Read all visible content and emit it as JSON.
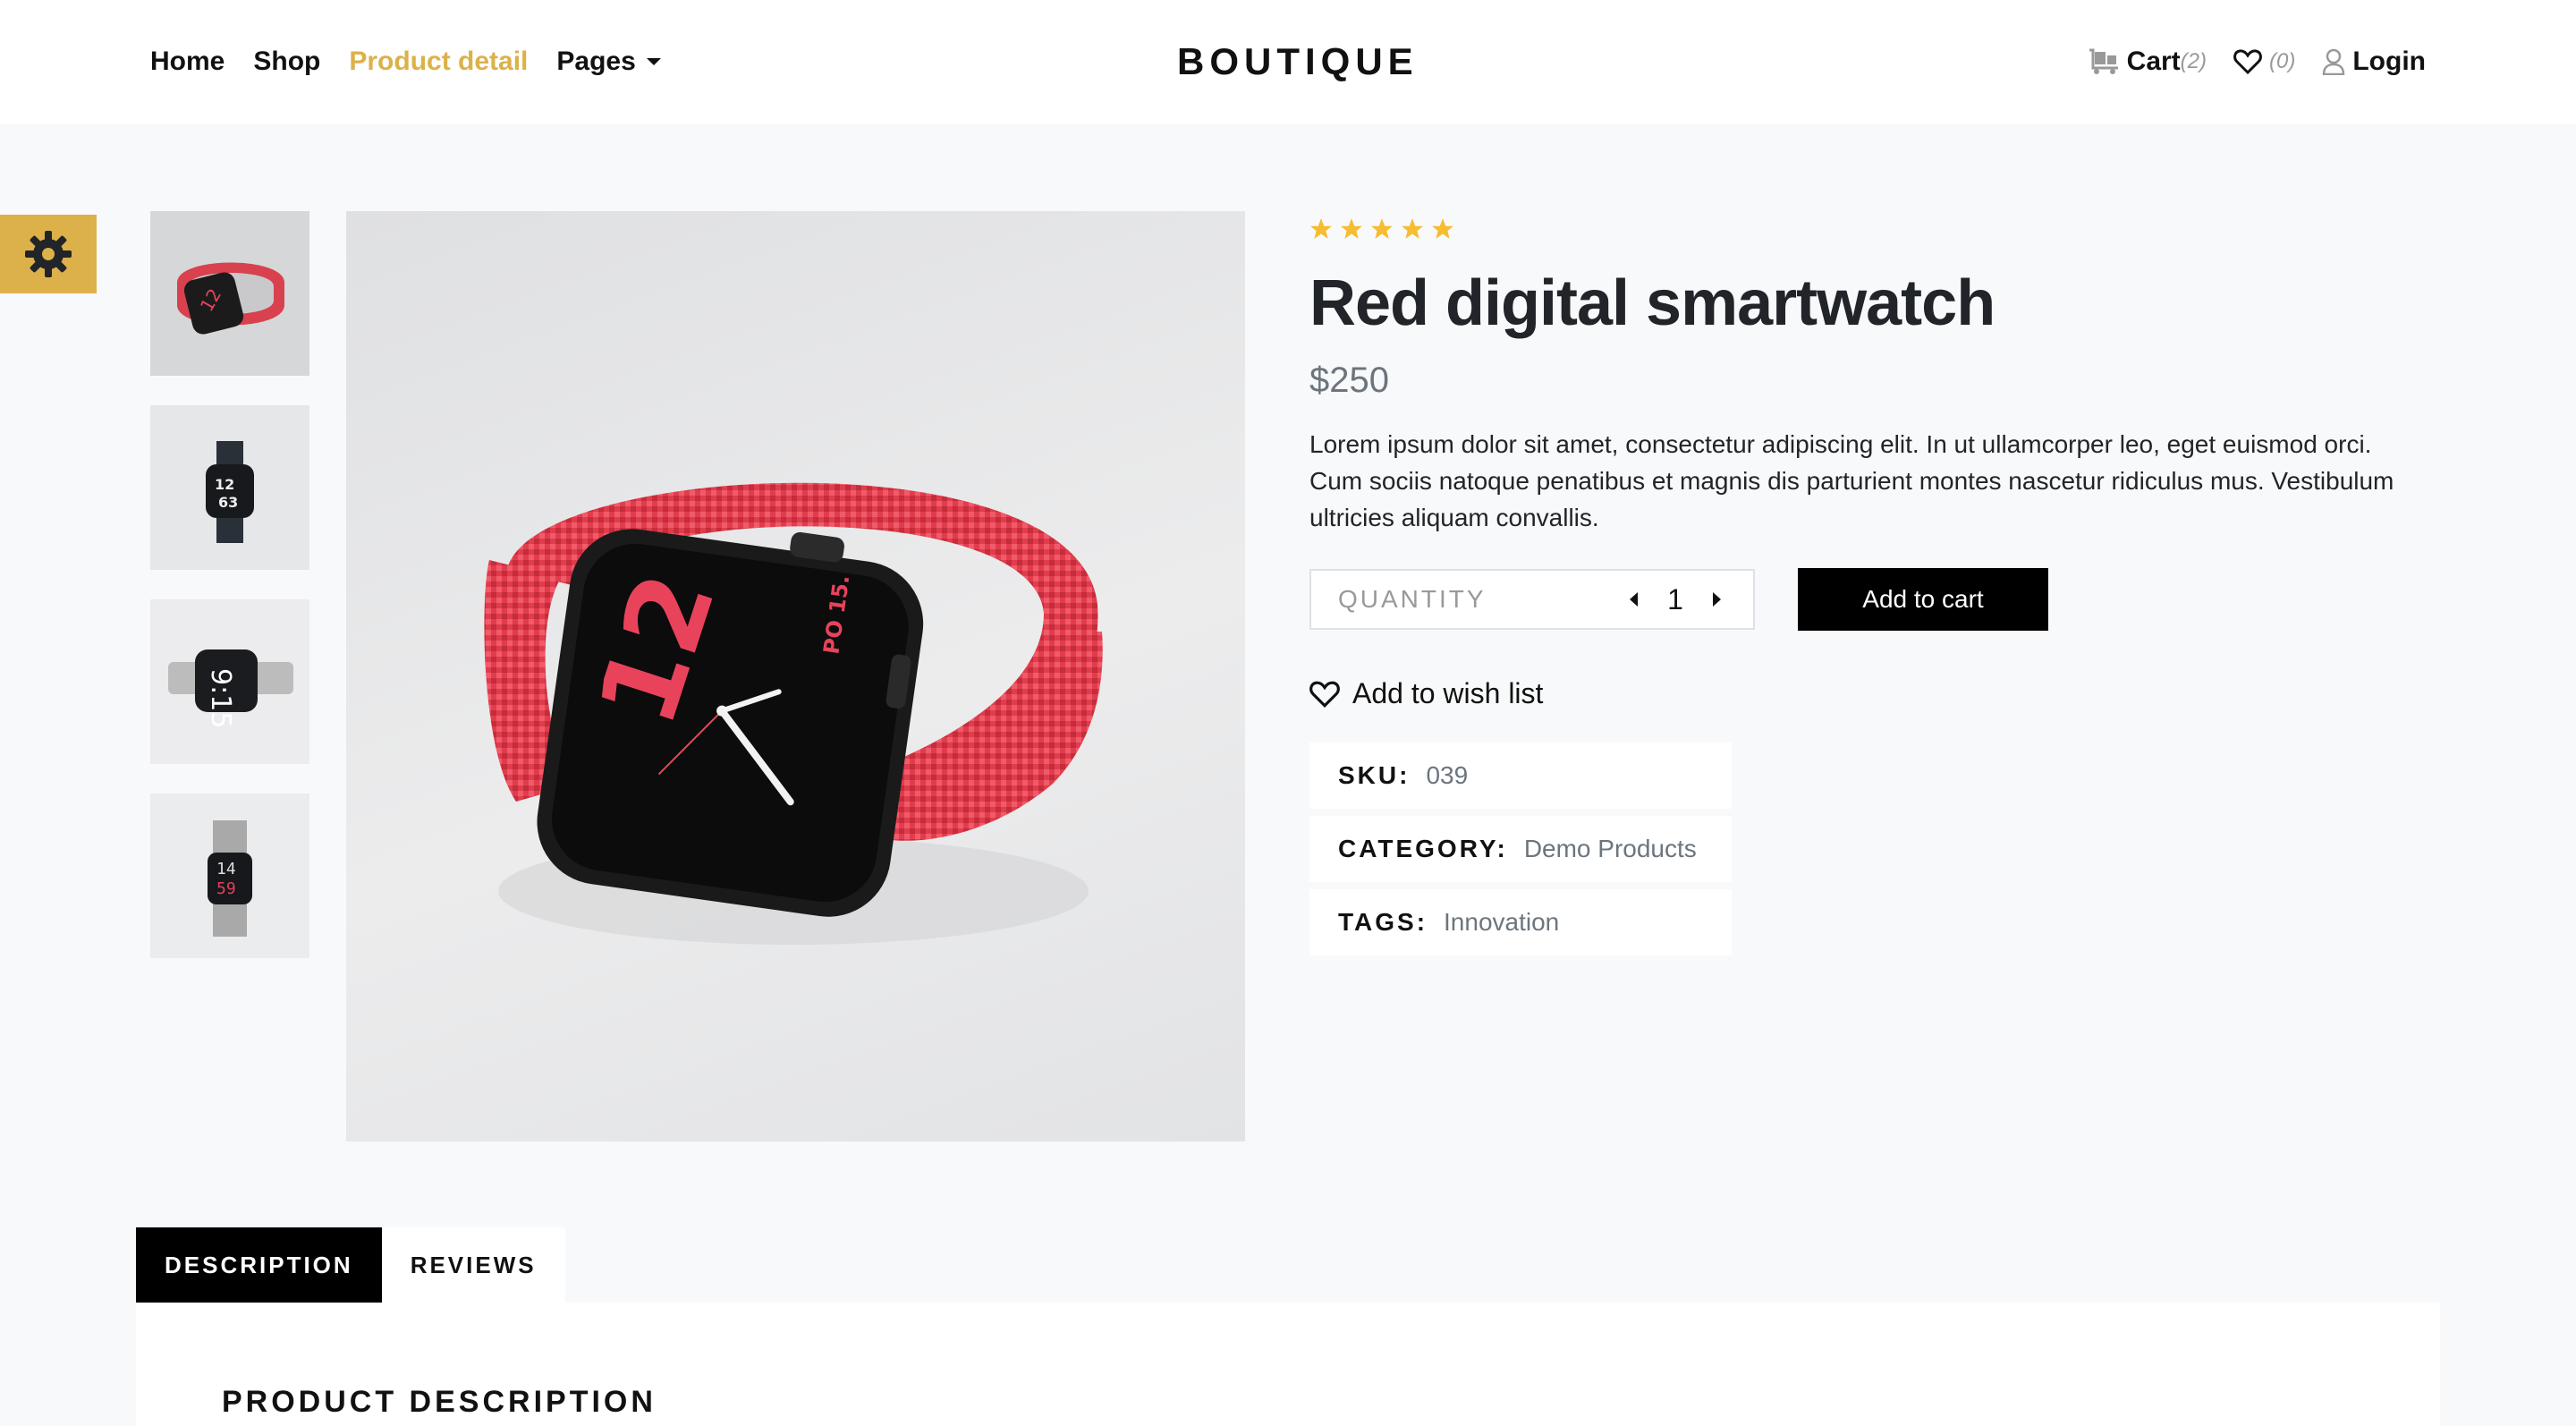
{
  "nav": {
    "links": [
      {
        "label": "Home"
      },
      {
        "label": "Shop"
      },
      {
        "label": "Product detail"
      },
      {
        "label": "Pages"
      }
    ],
    "brand": "BOUTIQUE",
    "cart_label": "Cart",
    "cart_count": "(2)",
    "wishlist_count": "(0)",
    "login_label": "Login"
  },
  "product": {
    "rating": 5,
    "title": "Red digital smartwatch",
    "price": "$250",
    "description": "Lorem ipsum dolor sit amet, consectetur adipiscing elit. In ut ullamcorper leo, eget euismod orci. Cum sociis natoque penatibus et magnis dis parturient montes nascetur ridiculus mus. Vestibulum ultricies aliquam convallis.",
    "quantity_label": "QUANTITY",
    "quantity_value": "1",
    "add_to_cart": "Add to cart",
    "wish_list": "Add to wish list",
    "meta": {
      "sku_key": "SKU:",
      "sku_val": "039",
      "category_key": "CATEGORY:",
      "category_val": "Demo Products",
      "tags_key": "TAGS:",
      "tags_val": "Innovation"
    }
  },
  "tabs": {
    "description": "DESCRIPTION",
    "reviews": "REVIEWS"
  },
  "panel": {
    "heading": "PRODUCT DESCRIPTION"
  },
  "colors": {
    "accent": "#dcb14a",
    "star": "#f5bd2f",
    "strap": "#e0404f"
  }
}
